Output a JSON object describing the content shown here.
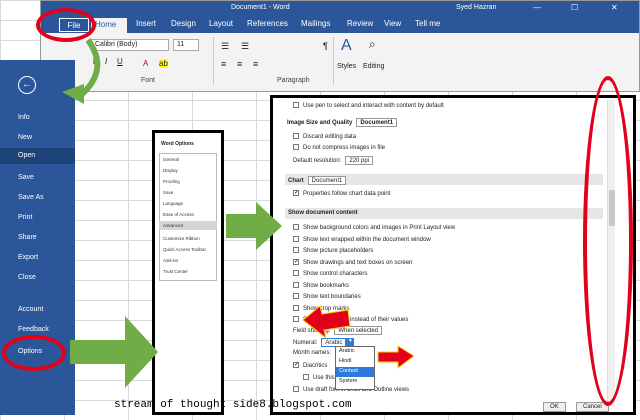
{
  "titlebar": {
    "title": "Document1 - Word",
    "user": "Syed Hazran",
    "ctrl_min": "—",
    "ctrl_max": "☐",
    "ctrl_close": "✕"
  },
  "tabs": [
    "File",
    "Home",
    "Insert",
    "Design",
    "Layout",
    "References",
    "Mailings",
    "Review",
    "View",
    "Tell me"
  ],
  "ribbon": {
    "font": "Calibri (Body)",
    "size": "11",
    "group_font": "Font",
    "group_paragraph": "Paragraph",
    "styles": "Styles",
    "editing": "Editing"
  },
  "backstage": [
    "Info",
    "New",
    "Open",
    "Save",
    "Save As",
    "Print",
    "Share",
    "Export",
    "Close",
    "Account",
    "Feedback",
    "Options"
  ],
  "options_list": {
    "title": "Word Options",
    "items": [
      "General",
      "Display",
      "Proofing",
      "Save",
      "Language",
      "Ease of Access",
      "Advanced",
      "Customize Ribbon",
      "Quick Access Toolbar",
      "Add-ins",
      "Trust Center"
    ]
  },
  "advanced": {
    "top_row": "Use pen to select and interact with content by default",
    "image_section": "Image Size and Quality",
    "image_doc": "Document1",
    "discard": "Discard editing data",
    "no_compress": "Do not compress images in file",
    "resolution_label": "Default resolution:",
    "resolution_value": "220 ppi",
    "chart_section": "Chart",
    "chart_doc": "Document1",
    "chart_prop": "Properties follow chart data point",
    "show_section": "Show document content",
    "show_items": [
      {
        "label": "Show background colors and images in Print Layout view",
        "checked": false
      },
      {
        "label": "Show text wrapped within the document window",
        "checked": false
      },
      {
        "label": "Show picture placeholders",
        "checked": false
      },
      {
        "label": "Show drawings and text boxes on screen",
        "checked": true
      },
      {
        "label": "Show control characters",
        "checked": false
      },
      {
        "label": "Show bookmarks",
        "checked": false
      },
      {
        "label": "Show text boundaries",
        "checked": false
      },
      {
        "label": "Show crop marks",
        "checked": false
      },
      {
        "label": "Show field codes instead of their values",
        "checked": false
      }
    ],
    "field_shading_label": "Field shading:",
    "field_shading_value": "When selected",
    "numeral_label": "Numeral:",
    "numeral_value": "Arabic",
    "numeral_options": [
      "Arabic",
      "Hindi",
      "Context",
      "System"
    ],
    "month_label": "Month names:",
    "diacritics": "Diacritics",
    "use_this": "Use this color",
    "draft_font": "Use draft font in Draft and Outline views",
    "ok": "OK",
    "cancel": "Cancel"
  },
  "caption": "stream of thought side8.blogspot.com",
  "colors": {
    "word_blue": "#2b579a",
    "annotation_red": "#e2001a",
    "arrow_green": "#70ad47",
    "selection_blue": "#2f7ad8"
  }
}
